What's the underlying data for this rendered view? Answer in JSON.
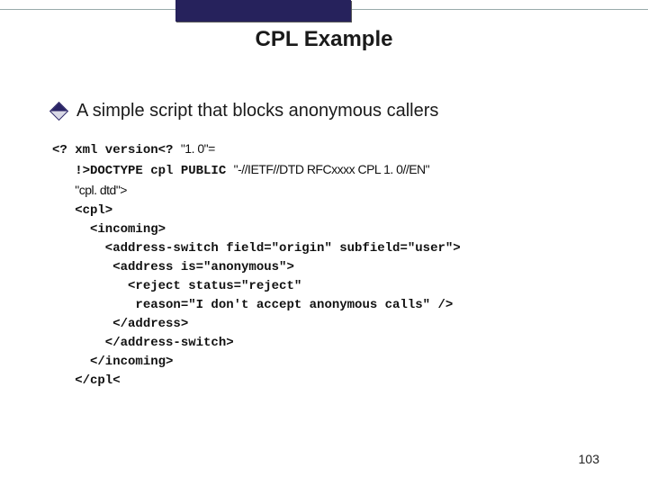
{
  "title": "CPL Example",
  "bullet": "A simple script that blocks anonymous callers",
  "code": {
    "l1a": "<? xml version<? ",
    "l1b": "\"1. 0\"=",
    "l2a": "   !>DOCTYPE cpl PUBLIC ",
    "l2b": "\"-//IETF//DTD RFCxxxx CPL 1. 0//EN\"",
    "l3a": "   ",
    "l3b": "\"cpl. dtd\">",
    "l4": "   <cpl>",
    "l5": "     <incoming>",
    "l6": "       <address-switch field=\"origin\" subfield=\"user\">",
    "l7": "        <address is=\"anonymous\">",
    "l8": "          <reject status=\"reject\"",
    "l9": "           reason=\"I don't accept anonymous calls\" />",
    "l10": "        </address>",
    "l11": "       </address-switch>",
    "l12": "     </incoming>",
    "l13": "   </cpl<"
  },
  "page_number": "103"
}
